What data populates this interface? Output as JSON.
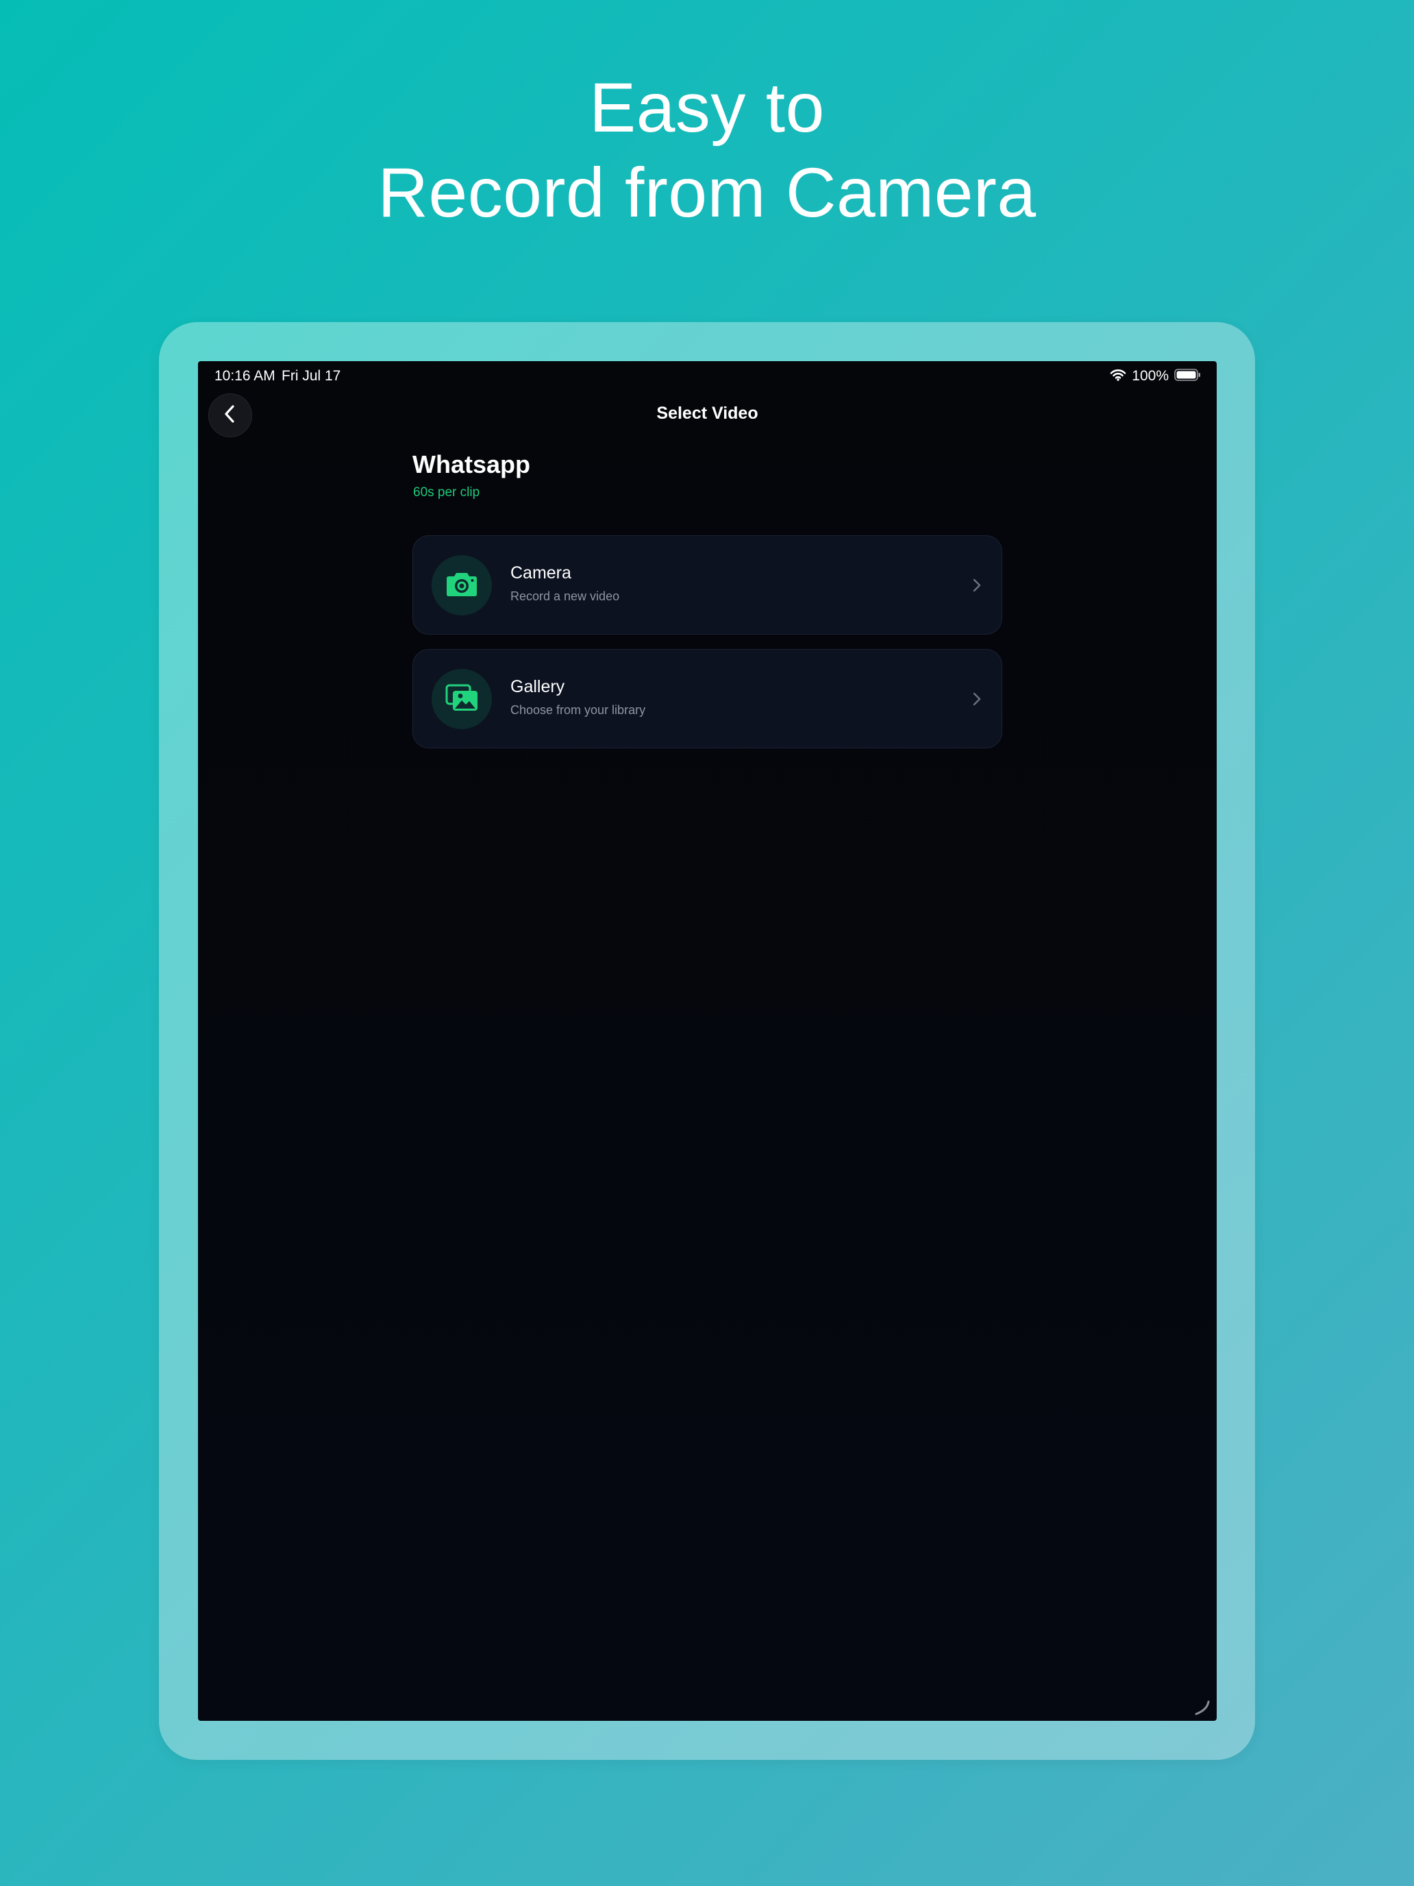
{
  "headline": {
    "line1": "Easy to",
    "line2": "Record from Camera"
  },
  "status_bar": {
    "time": "10:16 AM",
    "date": "Fri Jul 17",
    "battery": "100%"
  },
  "nav": {
    "title": "Select Video",
    "back_icon": "chevron-left-icon"
  },
  "section": {
    "title": "Whatsapp",
    "subtitle": "60s per clip"
  },
  "options": [
    {
      "title": "Camera",
      "subtitle": "Record a new video",
      "icon": "camera-icon"
    },
    {
      "title": "Gallery",
      "subtitle": "Choose from your library",
      "icon": "gallery-icon"
    }
  ],
  "colors": {
    "accent": "#22d37e",
    "screen_bg": "#05060a",
    "card_bg": "#0c1220",
    "icon_circle": "#0d2b2c",
    "subtitle_green": "#1fc97a",
    "frame": "#6ad1d1"
  }
}
